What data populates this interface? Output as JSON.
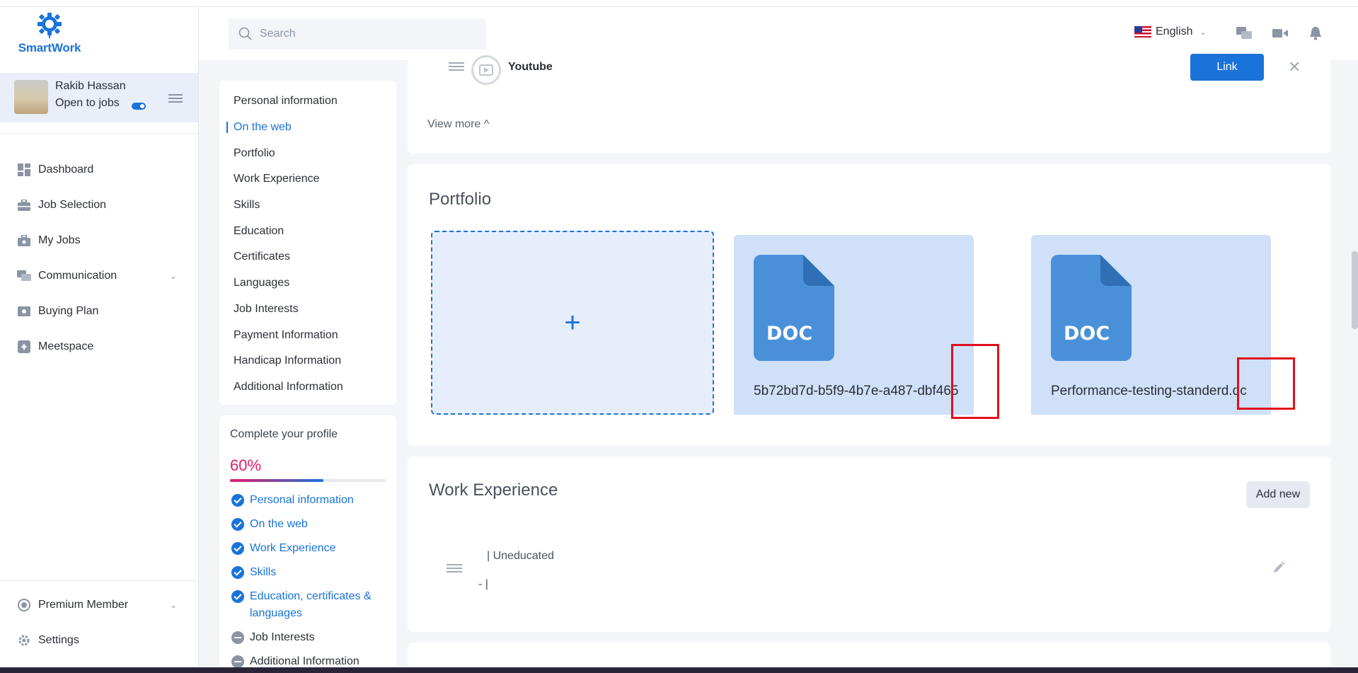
{
  "brand": {
    "name": "SmartWork"
  },
  "user": {
    "name": "Rakib Hassan",
    "status": "Open to jobs"
  },
  "sidebar": {
    "items": [
      {
        "label": "Dashboard",
        "icon": "dashboard-icon"
      },
      {
        "label": "Job Selection",
        "icon": "briefcase-icon"
      },
      {
        "label": "My Jobs",
        "icon": "job-bag-icon"
      },
      {
        "label": "Communication",
        "icon": "chat-icon"
      },
      {
        "label": "Buying Plan",
        "icon": "money-icon"
      },
      {
        "label": "Meetspace",
        "icon": "meetspace-icon"
      }
    ],
    "bottom": [
      {
        "label": "Premium Member",
        "icon": "premium-icon"
      },
      {
        "label": "Settings",
        "icon": "gear-icon"
      }
    ]
  },
  "header": {
    "search_placeholder": "Search",
    "language": "English"
  },
  "section_nav": {
    "items": [
      "Personal information",
      "On the web",
      "Portfolio",
      "Work Experience",
      "Skills",
      "Education",
      "Certificates",
      "Languages",
      "Job Interests",
      "Payment Information",
      "Handicap Information",
      "Additional Information"
    ],
    "active": "On the web"
  },
  "profile_completion": {
    "title": "Complete your profile",
    "percent_label": "60%",
    "percent": 0.6,
    "items": [
      {
        "label": "Personal information",
        "done": true
      },
      {
        "label": "On the web",
        "done": true
      },
      {
        "label": "Work Experience",
        "done": true
      },
      {
        "label": "Skills",
        "done": true
      },
      {
        "label": "Education, certificates & languages",
        "done": true
      },
      {
        "label": "Job Interests",
        "done": false
      },
      {
        "label": "Additional Information",
        "done": false
      }
    ]
  },
  "on_the_web": {
    "item_label": "Youtube",
    "link_button": "Link",
    "view_more": "View more ^"
  },
  "portfolio": {
    "title": "Portfolio",
    "add_symbol": "+",
    "files": [
      {
        "type": "DOC",
        "name": "5b72bd7d-b5f9-4b7e-a487-dbf465"
      },
      {
        "type": "DOC",
        "name": "Performance-testing-standerd.dc"
      }
    ]
  },
  "work_experience": {
    "title": "Work Experience",
    "add_button": "Add new",
    "entry_line1": "|  Uneducated",
    "entry_line2": "-  |"
  },
  "colors": {
    "accent": "#1a73d9",
    "percent": "#e01f6a",
    "highlight_box": "#e0101c",
    "doc_tile": "#cfe0f8"
  }
}
